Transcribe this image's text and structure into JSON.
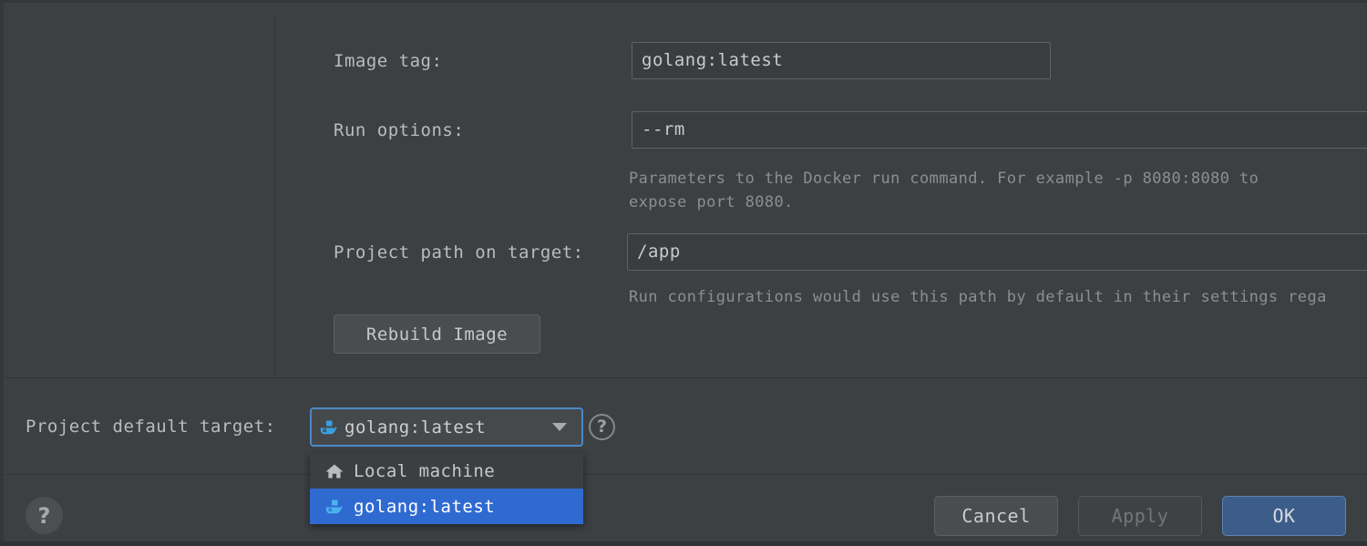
{
  "dialog": {
    "form": {
      "image_tag": {
        "label": "Image tag:",
        "value": "golang:latest"
      },
      "run_options": {
        "label": "Run options:",
        "value": "--rm",
        "hint_line_1": "Parameters to the Docker run command. For example -p 8080:8080 to",
        "hint_line_2": "expose port 8080."
      },
      "project_path": {
        "label": "Project path on target:",
        "value": "/app",
        "hint": "Run configurations would use this path by default in their settings rega"
      },
      "rebuild_button": "Rebuild Image"
    },
    "target_row": {
      "label": "Project default target:",
      "selected_value": "golang:latest",
      "selected_icon": "docker-icon",
      "help_glyph": "?",
      "dropdown_items": [
        {
          "label": "Local machine",
          "icon": "home-icon",
          "selected": false
        },
        {
          "label": "golang:latest",
          "icon": "docker-icon",
          "selected": true
        }
      ]
    },
    "footer": {
      "help_glyph": "?",
      "cancel_label": "Cancel",
      "apply_label": "Apply",
      "ok_label": "OK"
    },
    "colors": {
      "background": "#3c4043",
      "accent_blue": "#4a88c7",
      "selection_blue": "#2f6ad0",
      "ok_button_blue": "#3c5d89",
      "docker_icon_blue": "#3a9fe0",
      "text_primary": "#c6c9cb",
      "text_muted": "#8b8f91"
    }
  }
}
